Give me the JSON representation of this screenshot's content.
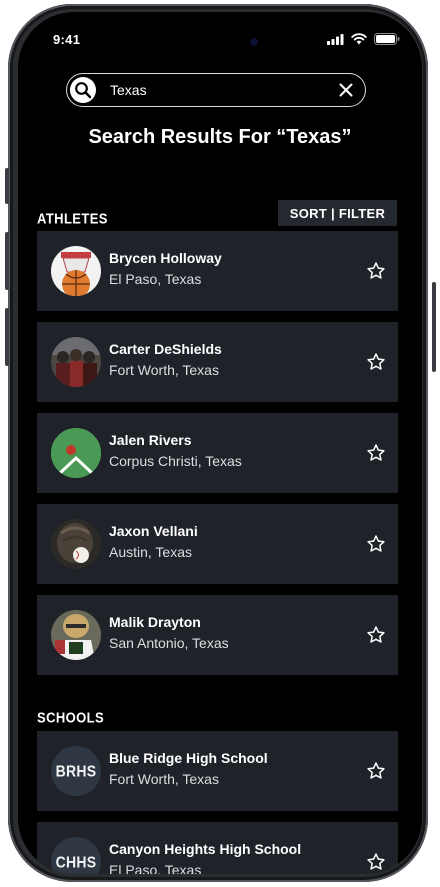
{
  "status_bar": {
    "time": "9:41"
  },
  "search": {
    "value": "Texas"
  },
  "results_title": "Search Results For “Texas”",
  "athletes": {
    "label": "ATHLETES",
    "sort_filter_label": "SORT | FILTER",
    "items": [
      {
        "name": "Brycen Holloway",
        "location": "El Paso, Texas"
      },
      {
        "name": "Carter DeShields",
        "location": "Fort Worth, Texas"
      },
      {
        "name": "Jalen Rivers",
        "location": "Corpus Christi, Texas"
      },
      {
        "name": "Jaxon Vellani",
        "location": "Austin, Texas"
      },
      {
        "name": "Malik Drayton",
        "location": "San Antonio, Texas"
      }
    ]
  },
  "schools": {
    "label": "SCHOOLS",
    "items": [
      {
        "initials": "BRHS",
        "name": "Blue Ridge High School",
        "location": "Fort Worth, Texas"
      },
      {
        "initials": "CHHS",
        "name": "Canyon Heights High School",
        "location": "El Paso, Texas"
      }
    ]
  },
  "colors": {
    "background": "#000000",
    "card": "#1f2329",
    "button": "#24282f",
    "text": "#ffffff"
  }
}
